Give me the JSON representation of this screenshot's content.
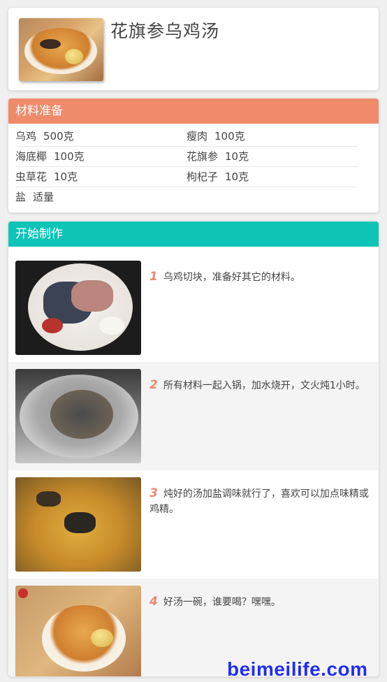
{
  "recipe": {
    "title": "花旗参乌鸡汤"
  },
  "ingredients": {
    "header": "材料准备",
    "header_color": "#ef8a6a",
    "items": [
      {
        "name": "乌鸡",
        "amount": "500克"
      },
      {
        "name": "瘦肉",
        "amount": "100克"
      },
      {
        "name": "海底椰",
        "amount": "100克"
      },
      {
        "name": "花旗参",
        "amount": "10克"
      },
      {
        "name": "虫草花",
        "amount": "10克"
      },
      {
        "name": "枸杞子",
        "amount": "10克"
      },
      {
        "name": "盐",
        "amount": "适量"
      }
    ]
  },
  "steps": {
    "header": "开始制作",
    "header_color": "#0ec4b6",
    "number_color": "#e88a6e",
    "items": [
      {
        "num": "1",
        "text": "乌鸡切块，准备好其它的材料。"
      },
      {
        "num": "2",
        "text": "所有材料一起入锅，加水烧开，文火炖1小时。"
      },
      {
        "num": "3",
        "text": "炖好的汤加盐调味就行了，喜欢可以加点味精或鸡精。"
      },
      {
        "num": "4",
        "text": "好汤一碗，谁要喝？嘿嘿。"
      }
    ]
  },
  "watermark": {
    "text": "beimeilife.com",
    "color": "#1f2cff"
  }
}
